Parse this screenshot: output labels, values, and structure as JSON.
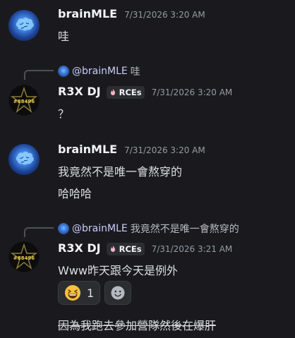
{
  "messages": [
    {
      "username": "brainMLE",
      "timestamp": "7/31/2026 3:20 AM",
      "lines": [
        "哇"
      ]
    },
    {
      "reply": {
        "mention": "@brainMLE",
        "text": "哇"
      },
      "username": "R3X DJ",
      "badge": "RCEs",
      "timestamp": "7/31/2026 3:20 AM",
      "lines": [
        "？"
      ]
    },
    {
      "username": "brainMLE",
      "timestamp": "7/31/2026 3:20 AM",
      "lines": [
        "我竟然不是唯一會熬穿的",
        "哈哈哈"
      ]
    },
    {
      "reply": {
        "mention": "@brainMLE",
        "text": "我竟然不是唯一會熬穿的"
      },
      "username": "R3X DJ",
      "badge": "RCEs",
      "timestamp": "7/31/2026 3:21 AM",
      "lines": [
        "Www昨天跟今天是例外"
      ],
      "reactions": [
        {
          "emoji": "grinning-squint-emoji",
          "count": "1"
        }
      ],
      "strikethrough_line": "因為我跑去參加營隊然後在爆肝"
    }
  ],
  "avatar_text": "#88496",
  "colors": {
    "background": "#1a1a1e",
    "username": "#f2f3f5",
    "timestamp": "#949ba4",
    "mention": "#c9cdfb",
    "reaction_bg": "#2b2d31"
  }
}
